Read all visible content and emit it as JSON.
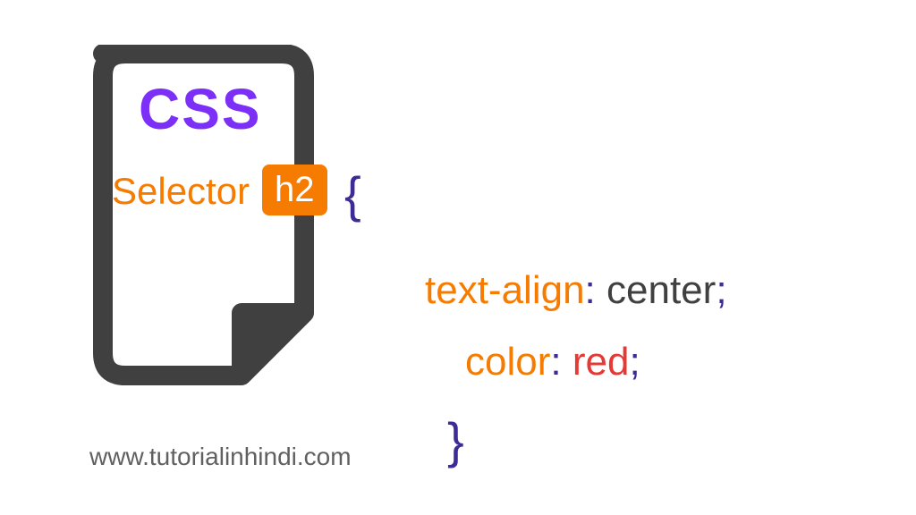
{
  "title": "CSS",
  "selectorLabel": "Selector",
  "selectorBadge": "h2",
  "braceOpen": "{",
  "braceClose": "}",
  "rule1": {
    "property": "text-align",
    "colon": ":",
    "value": "center",
    "semicolon": ";"
  },
  "rule2": {
    "property": "color",
    "colon": ":",
    "value": "red",
    "semicolon": ";"
  },
  "website": "www.tutorialinhindi.com"
}
